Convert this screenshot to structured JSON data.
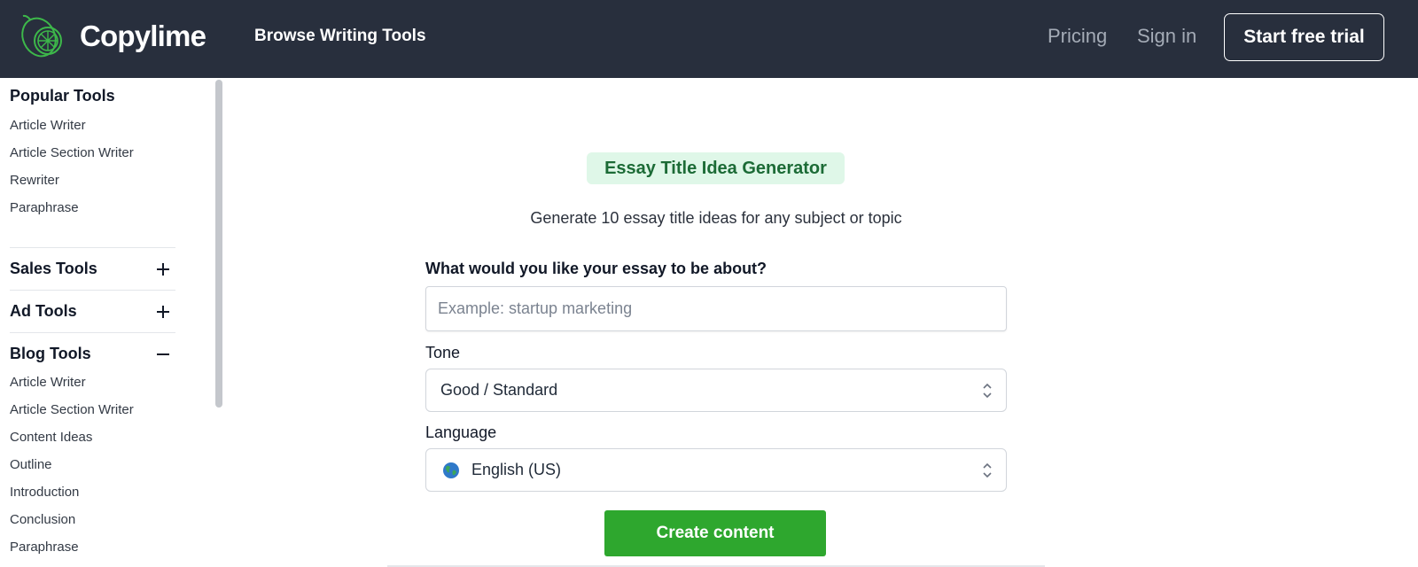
{
  "header": {
    "brand": "Copylime",
    "browse_label": "Browse Writing Tools",
    "pricing_label": "Pricing",
    "signin_label": "Sign in",
    "trial_label": "Start free trial",
    "logo_icon": "lime-icon",
    "background": "#282f3d",
    "logo_color": "#3db84a"
  },
  "sidebar": {
    "popular_heading": "Popular Tools",
    "popular_items": [
      "Article Writer",
      "Article Section Writer",
      "Rewriter",
      "Paraphrase"
    ],
    "sales_heading": "Sales Tools",
    "ad_heading": "Ad Tools",
    "blog_heading": "Blog Tools",
    "blog_items": [
      "Article Writer",
      "Article Section Writer",
      "Content Ideas",
      "Outline",
      "Introduction",
      "Conclusion",
      "Paraphrase"
    ],
    "expand_icon": "plus-icon",
    "collapse_icon": "minus-icon"
  },
  "main": {
    "badge": "Essay Title Idea Generator",
    "subtitle": "Generate 10 essay title ideas for any subject or topic",
    "question_label": "What would you like your essay to be about?",
    "question_placeholder": "Example: startup marketing",
    "question_value": "",
    "tone_label": "Tone",
    "tone_value": "Good / Standard",
    "language_label": "Language",
    "language_value": "English (US)",
    "language_icon": "globe-icon",
    "create_label": "Create content",
    "badge_bg": "#dff7e8",
    "badge_color": "#1c6b36",
    "button_color": "#2ea72e"
  }
}
